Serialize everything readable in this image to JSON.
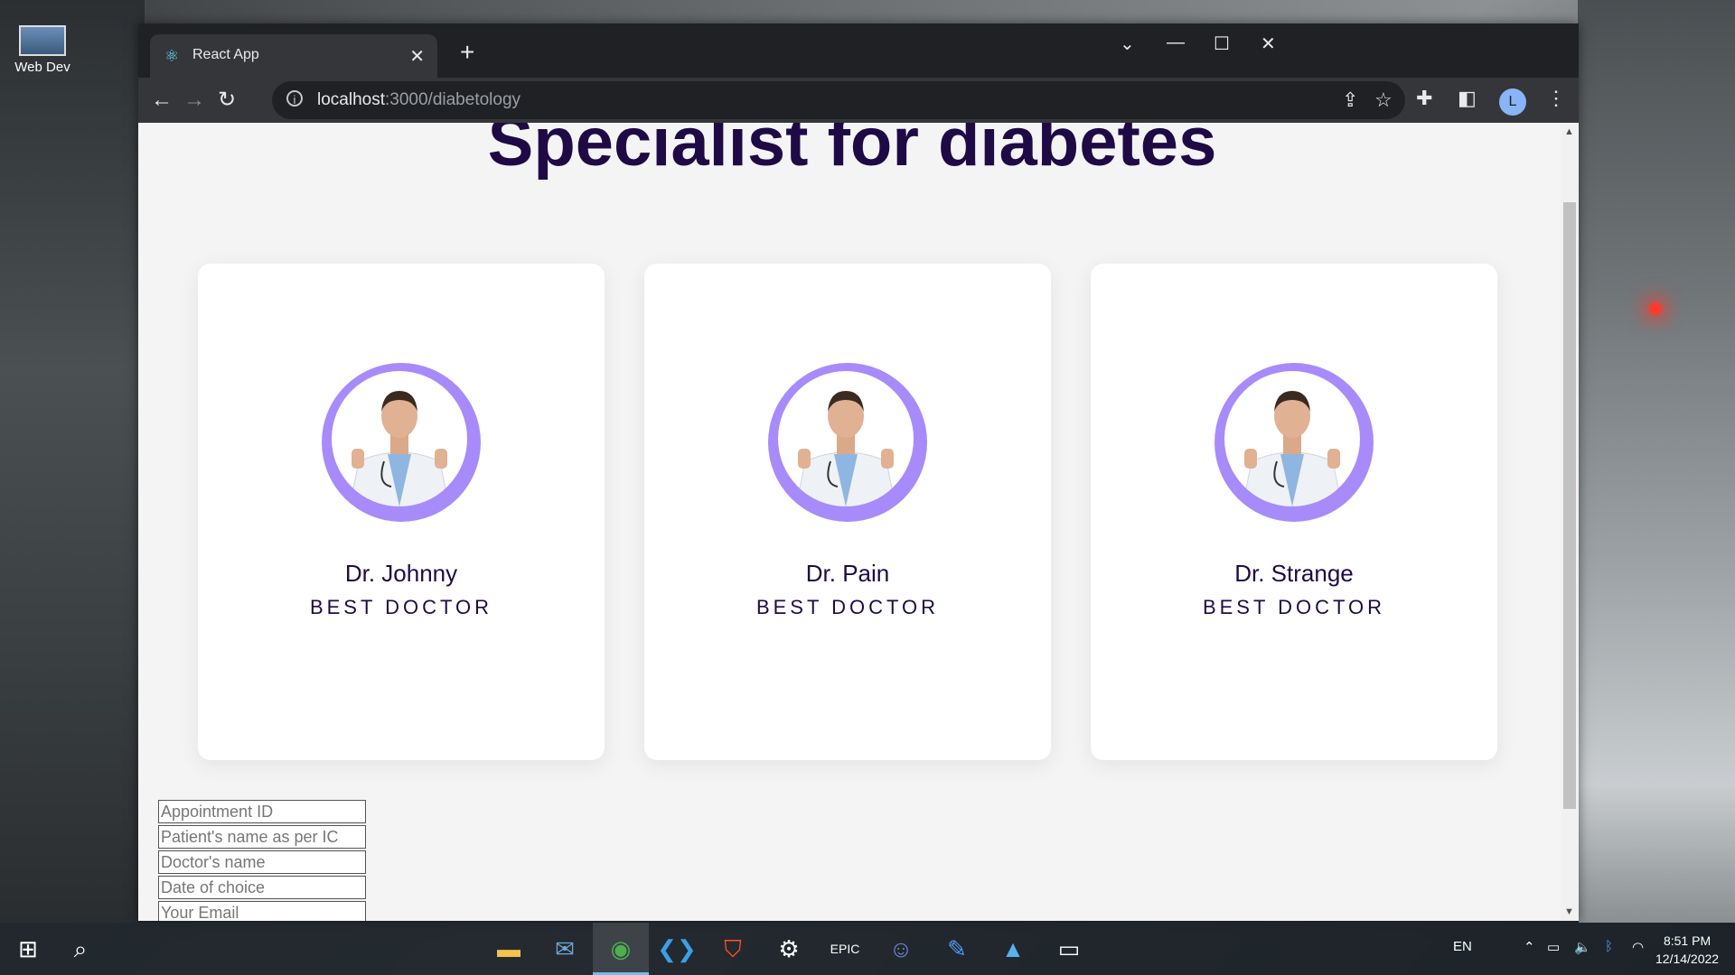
{
  "desktop": {
    "icon_label": "Web Dev"
  },
  "browser": {
    "tab_title": "React App",
    "url_host": "localhost",
    "url_path": ":3000/diabetology",
    "profile_initial": "L"
  },
  "page": {
    "title": "Specialist for diabetes",
    "doctors": [
      {
        "name": "Dr. Johnny",
        "role": "BEST DOCTOR"
      },
      {
        "name": "Dr. Pain",
        "role": "BEST DOCTOR"
      },
      {
        "name": "Dr. Strange",
        "role": "BEST DOCTOR"
      }
    ],
    "form": {
      "appointment_id_placeholder": "Appointment ID",
      "patient_name_placeholder": "Patient's name as per IC",
      "doctor_name_placeholder": "Doctor's name",
      "date_placeholder": "Date of choice",
      "email_placeholder": "Your Email"
    }
  },
  "taskbar": {
    "language": "EN",
    "time": "8:51 PM",
    "date": "12/14/2022",
    "apps": [
      "file-explorer",
      "mail",
      "chrome",
      "vscode",
      "brave",
      "steam",
      "epic-games",
      "discord",
      "app",
      "photos",
      "terminal"
    ]
  },
  "colors": {
    "title": "#1e0a45",
    "ring": "#a78bfa",
    "card": "#ffffff",
    "page_bg": "#f4f4f5"
  }
}
